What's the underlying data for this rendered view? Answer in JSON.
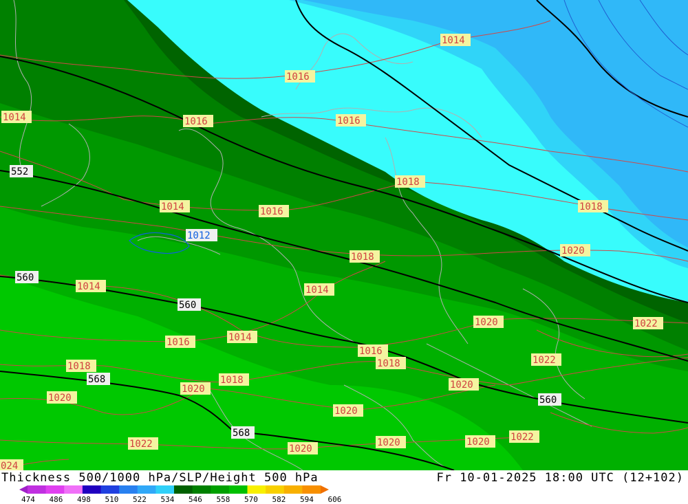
{
  "title": {
    "left": "Thickness 500/1000 hPa/SLP/Height 500 hPa",
    "right": "Fr 10-01-2025 18:00 UTC (12+102)"
  },
  "colors": {
    "thickness_bands": [
      "#a020c8",
      "#c030e0",
      "#e040f0",
      "#f070f8",
      "#2000c0",
      "#2040e0",
      "#2880f0",
      "#30a8f8",
      "#30d0f8",
      "#006000",
      "#008000",
      "#00a000",
      "#00c000",
      "#f8f000",
      "#f8d000",
      "#f8b000",
      "#f89000",
      "#f07000"
    ],
    "slp_contour": "#d04040",
    "height_contour": "#000000",
    "border": "#a0a0a0"
  },
  "legend": {
    "ticks": [
      "474",
      "486",
      "498",
      "510",
      "522",
      "534",
      "546",
      "558",
      "570",
      "582",
      "594",
      "606"
    ]
  },
  "slp_labels": {
    "l1014a": "1014",
    "l1016a": "1016",
    "l1014b": "1014",
    "l1016b": "1016",
    "l1016c": "1016",
    "l1018a": "1018",
    "l1018b": "1018",
    "l1014c": "1014",
    "l1016d": "1016",
    "l1012": "1012",
    "l1018c": "1018",
    "l1020a": "1020",
    "l1014d": "1014",
    "l1014e": "1014",
    "l1020b": "1020",
    "l1022a": "1022",
    "l1016e": "1016",
    "l1014f": "1014",
    "l1016f": "1016",
    "l1018d": "1018",
    "l1022b": "1022",
    "l1018e": "1018",
    "l1018f": "1018",
    "l1020c": "1020",
    "l1020d": "1020",
    "l1020e": "1020",
    "l1020f": "1020",
    "l1022c": "1022",
    "l1020g": "1020",
    "l1022d": "1022",
    "l1020h": "1020",
    "l1024": "024"
  },
  "height_labels": {
    "h552": "552",
    "h560a": "560",
    "h560b": "560",
    "h560c": "560",
    "h568a": "568",
    "h568b": "568"
  }
}
